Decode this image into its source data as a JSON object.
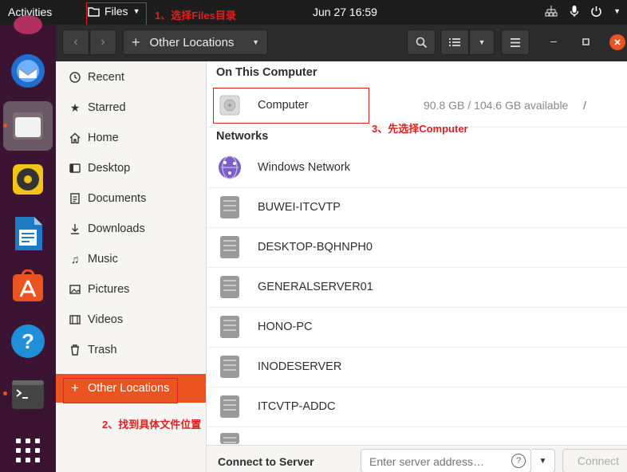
{
  "topbar": {
    "activities": "Activities",
    "app_menu": "Files",
    "clock": "Jun 27  16:59"
  },
  "annotations": {
    "step1": "1、选择Files目录",
    "step2": "2、找到具体文件位置",
    "step3": "3、先选择Computer"
  },
  "dock": [
    "thunderbird-icon",
    "files-icon",
    "rhythmbox-icon",
    "libreoffice-writer-icon",
    "ubuntu-software-icon",
    "help-icon",
    "terminal-icon",
    "show-apps-icon"
  ],
  "headerbar": {
    "path_label": "Other Locations"
  },
  "sidebar": {
    "items": [
      {
        "label": "Recent",
        "icon": "clock-icon"
      },
      {
        "label": "Starred",
        "icon": "star-icon"
      },
      {
        "label": "Home",
        "icon": "home-icon"
      },
      {
        "label": "Desktop",
        "icon": "desktop-icon"
      },
      {
        "label": "Documents",
        "icon": "documents-icon"
      },
      {
        "label": "Downloads",
        "icon": "downloads-icon"
      },
      {
        "label": "Music",
        "icon": "music-icon"
      },
      {
        "label": "Pictures",
        "icon": "pictures-icon"
      },
      {
        "label": "Videos",
        "icon": "videos-icon"
      },
      {
        "label": "Trash",
        "icon": "trash-icon"
      },
      {
        "label": "Other Locations",
        "icon": "plus-icon"
      }
    ]
  },
  "main": {
    "on_this_computer": "On This Computer",
    "computer": {
      "name": "Computer",
      "space": "90.8 GB / 104.6 GB available",
      "mount": "/"
    },
    "networks": "Networks",
    "network_items": [
      {
        "name": "Windows Network"
      },
      {
        "name": "BUWEI-ITCVTP"
      },
      {
        "name": "DESKTOP-BQHNPH0"
      },
      {
        "name": "GENERALSERVER01"
      },
      {
        "name": "HONO-PC"
      },
      {
        "name": "INODESERVER"
      },
      {
        "name": "ITCVTP-ADDC"
      }
    ]
  },
  "bottom": {
    "label": "Connect to Server",
    "placeholder": "Enter server address…",
    "help": "?",
    "connect": "Connect"
  },
  "colors": {
    "accent": "#e95420",
    "annotation": "#e02020"
  }
}
